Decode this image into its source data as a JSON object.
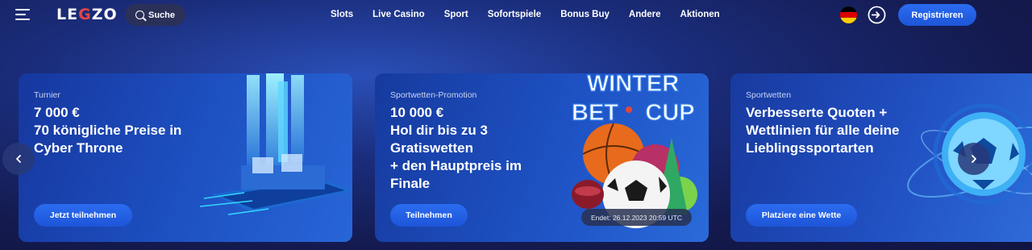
{
  "header": {
    "logo": {
      "before": "LE",
      "accent": "G",
      "after": "ZO"
    },
    "search_label": "Suche",
    "nav": [
      "Slots",
      "Live Casino",
      "Sport",
      "Sofortspiele",
      "Bonus Buy",
      "Andere",
      "Aktionen"
    ],
    "register_label": "Registrieren"
  },
  "cards": [
    {
      "tag": "Turnier",
      "title_lines": [
        "7 000 €",
        "70 königliche Preise in",
        "Cyber Throne"
      ],
      "button": "Jetzt teilnehmen"
    },
    {
      "tag": "Sportwetten-Promotion",
      "title_lines": [
        "10 000 €",
        "Hol dir bis zu 3",
        "Gratiswetten",
        "+ den Hauptpreis im",
        "Finale"
      ],
      "button": "Teilnehmen",
      "art_text": [
        "WINTER",
        "BET",
        "CUP"
      ],
      "ends": "Endet: 26.12.2023 20:59 UTC"
    },
    {
      "tag": "Sportwetten",
      "title_lines": [
        "Verbesserte Quoten +",
        "Wettlinien für alle deine",
        "Lieblingssportarten"
      ],
      "button": "Platziere eine Wette"
    }
  ],
  "colors": {
    "accent_button": "#1d55d8",
    "logo_accent": "#e64343",
    "flag": [
      "#000000",
      "#dd0000",
      "#ffce00"
    ]
  },
  "icons": [
    "burger-menu-icon",
    "search-icon",
    "germany-flag-icon",
    "login-icon",
    "arrow-left-icon",
    "arrow-right-icon"
  ]
}
